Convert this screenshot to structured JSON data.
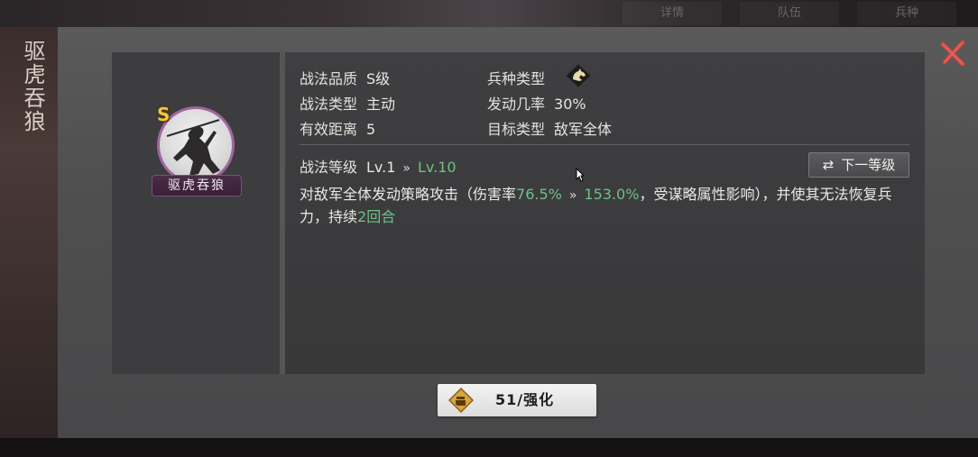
{
  "skill": {
    "title": "驱虎吞狼",
    "grade_badge": "S",
    "name_plate": "驱虎吞狼"
  },
  "attributes": [
    {
      "label": "战法品质",
      "value": "S级"
    },
    {
      "label": "兵种类型",
      "value": ""
    },
    {
      "label": "战法类型",
      "value": "主动"
    },
    {
      "label": "发动几率",
      "value": "30%"
    },
    {
      "label": "有效距离",
      "value": "5"
    },
    {
      "label": "目标类型",
      "value": "敌军全体"
    }
  ],
  "level": {
    "label": "战法等级",
    "current": "Lv.1",
    "arrow": "»",
    "next": "Lv.10",
    "next_button": "下一等级"
  },
  "description": {
    "part1": "对敌军全体发动策略攻击（伤害率",
    "dmg_from": "76.5%",
    "arrow": "»",
    "dmg_to": "153.0%",
    "part2": "，受谋略属性影响），并使其无法恢复兵力，持续",
    "turns": "2回合"
  },
  "upgrade_button": {
    "label": "51/强化"
  },
  "top_tabs": [
    "详情",
    "队伍",
    "兵种"
  ],
  "colors": {
    "highlight_green": "#6cc287",
    "close_red": "#c8463f",
    "grade_gold": "#f0c640"
  },
  "icons": {
    "troop_type": "horse-head-icon",
    "close": "close-x-icon",
    "swap": "swap-arrows-icon",
    "upgrade": "fist-icon"
  }
}
